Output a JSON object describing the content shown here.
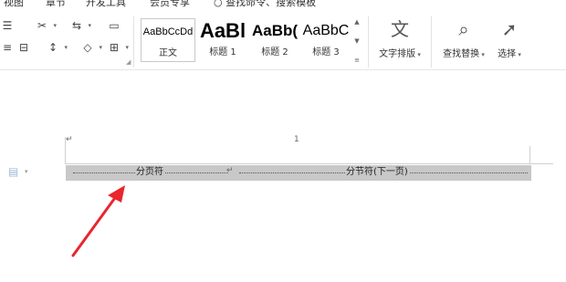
{
  "menu": {
    "items": [
      {
        "label": "视图"
      },
      {
        "label": "章节"
      },
      {
        "label": "开发工具"
      },
      {
        "label": "会员专享"
      }
    ],
    "search_placeholder": "查找命令、搜索模板"
  },
  "ribbon": {
    "styles": [
      {
        "preview": "AaBbCcDd",
        "name": "正文"
      },
      {
        "preview": "AaBl",
        "name": "标题 1"
      },
      {
        "preview": "AaBb(",
        "name": "标题 2"
      },
      {
        "preview": "AaBbC",
        "name": "标题 3"
      }
    ],
    "text_layout_label": "文字排版",
    "find_replace_label": "查找替换",
    "select_label": "选择"
  },
  "document": {
    "page_number": "1",
    "page_break_label": "分页符",
    "section_break_label": "分节符(下一页)",
    "paragraph_mark": "↵"
  },
  "annotation": {
    "arrow_color": "#e8262c"
  }
}
